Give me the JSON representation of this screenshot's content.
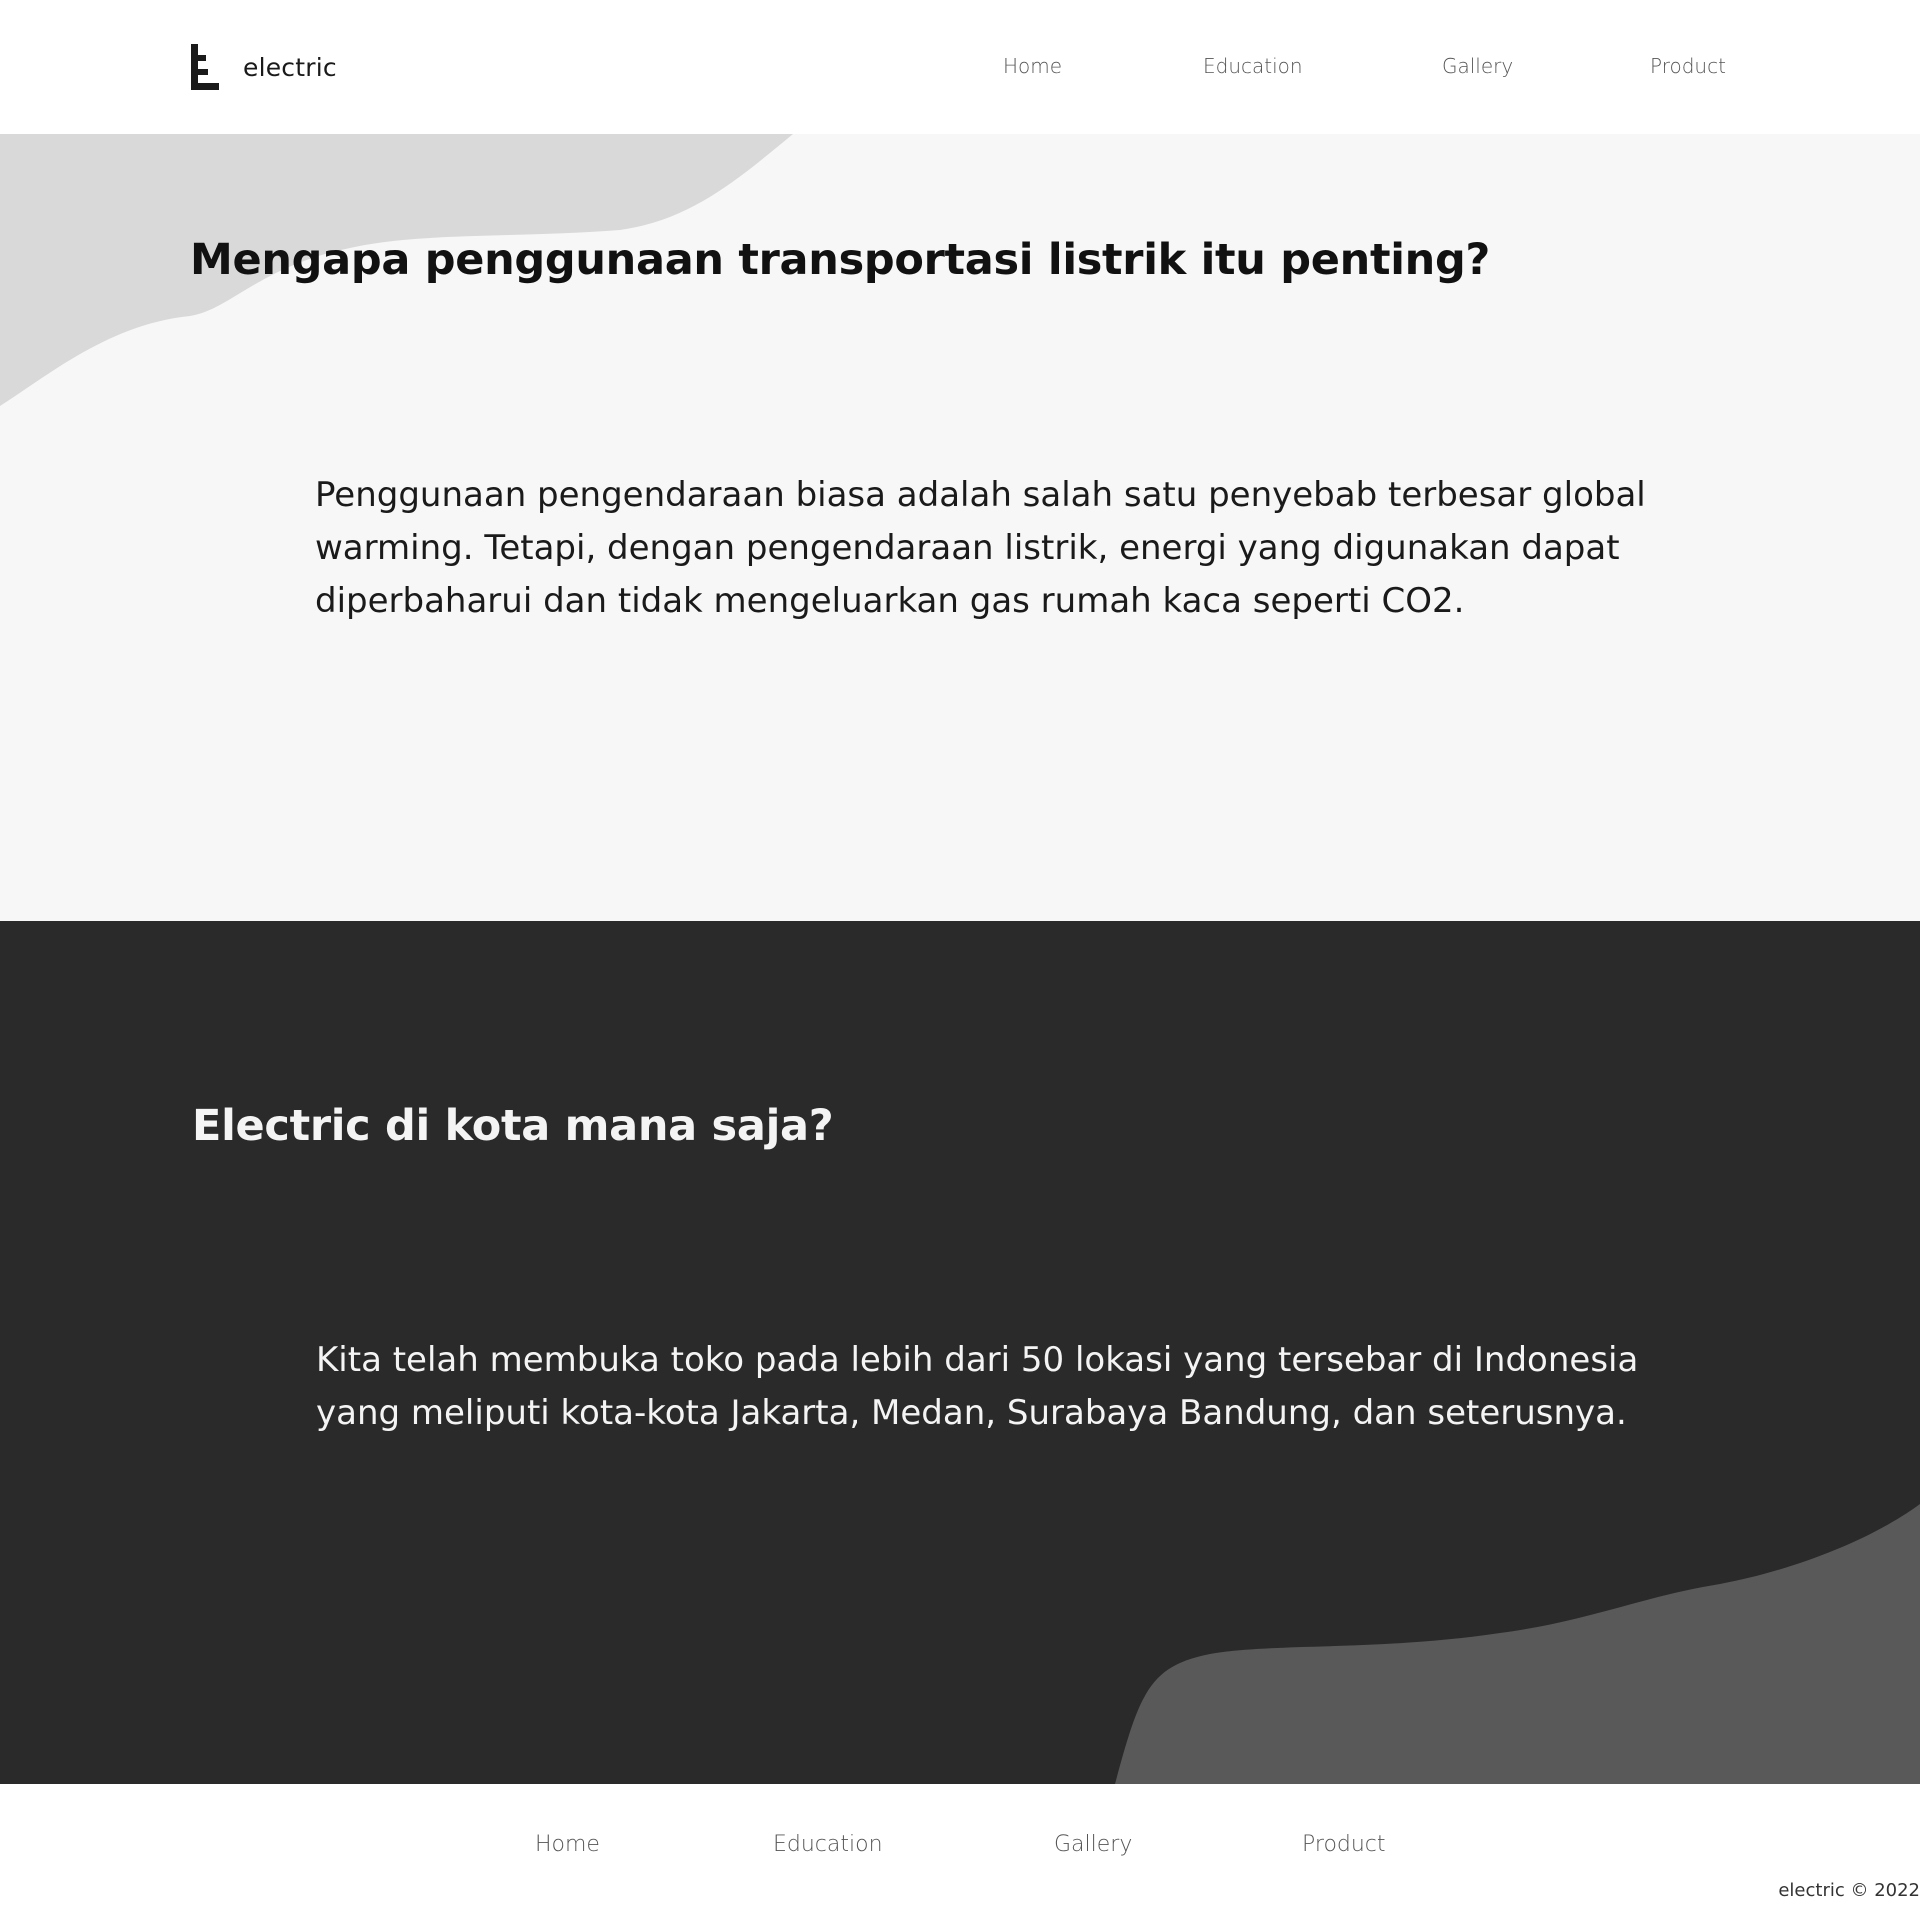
{
  "header": {
    "brand": "electric",
    "nav": [
      "Home",
      "Education",
      "Gallery",
      "Product"
    ]
  },
  "section_why": {
    "title": "Mengapa penggunaan transportasi listrik itu penting?",
    "body": "Penggunaan pengendaraan biasa adalah salah satu penyebab terbesar global warming. Tetapi, dengan pengendaraan listrik, energi yang digunakan dapat diperbaharui dan tidak mengeluarkan gas rumah kaca seperti CO2."
  },
  "section_cities": {
    "title": "Electric di kota mana saja?",
    "body": "Kita telah membuka toko pada lebih dari 50 lokasi yang tersebar di Indonesia yang meliputi kota-kota Jakarta, Medan, Surabaya Bandung, dan seterusnya."
  },
  "footer": {
    "nav": [
      "Home",
      "Education",
      "Gallery",
      "Product"
    ],
    "copyright": "electric © 2022"
  },
  "colors": {
    "light_bg": "#f7f7f7",
    "light_blob": "#d9d9d9",
    "dark_bg": "#2a2a2a",
    "dark_blob": "#595959",
    "nav_text": "#555555"
  }
}
